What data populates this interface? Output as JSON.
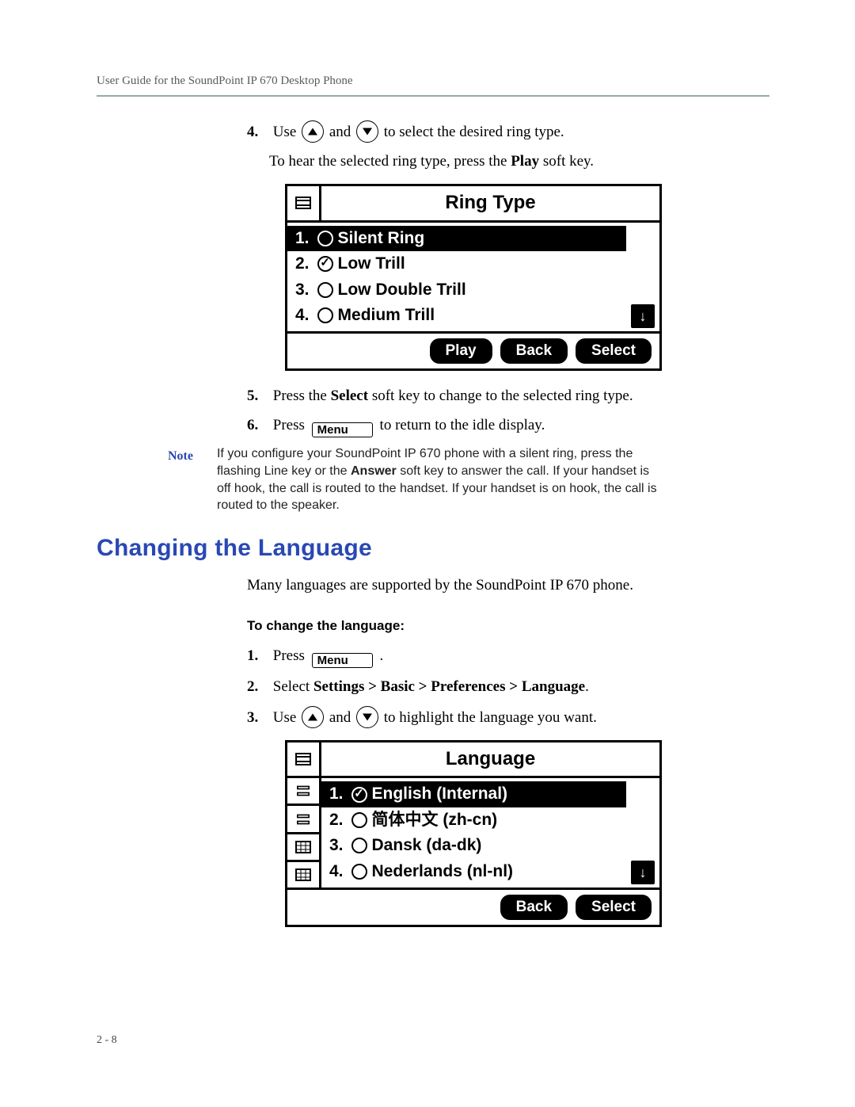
{
  "running_head": "User Guide for the SoundPoint IP 670 Desktop Phone",
  "steps_a": {
    "s4": {
      "num": "4.",
      "pre": "Use ",
      "mid": " and ",
      "post": " to select the desired ring type."
    },
    "s4b": {
      "pre": "To hear the selected ring type, press the ",
      "bold": "Play",
      "post": " soft key."
    },
    "s5": {
      "num": "5.",
      "pre": "Press the ",
      "bold": "Select",
      "post": " soft key to change to the selected ring type."
    },
    "s6": {
      "num": "6.",
      "pre": "Press ",
      "post": " to return to the idle display."
    }
  },
  "menu_key_label": "Menu",
  "ring_panel": {
    "title": "Ring Type",
    "items": [
      {
        "n": "1.",
        "checked": false,
        "label": "Silent Ring",
        "selected": true
      },
      {
        "n": "2.",
        "checked": true,
        "label": "Low Trill",
        "selected": false
      },
      {
        "n": "3.",
        "checked": false,
        "label": "Low Double Trill",
        "selected": false
      },
      {
        "n": "4.",
        "checked": false,
        "label": "Medium Trill",
        "selected": false
      }
    ],
    "softkeys": [
      "Play",
      "Back",
      "Select"
    ]
  },
  "note": {
    "label": "Note",
    "text_a": "If you configure your SoundPoint IP 670 phone with a silent ring, press the flashing Line key or the ",
    "bold": "Answer",
    "text_b": " soft key to answer the call. If your handset is off hook, the call is routed to the handset. If your handset is on hook, the call is routed to the speaker."
  },
  "section_title": "Changing the Language",
  "intro": "Many languages are supported by the SoundPoint IP 670 phone.",
  "subhead": "To change the language:",
  "steps_b": {
    "s1": {
      "num": "1.",
      "pre": "Press ",
      "post": " ."
    },
    "s2": {
      "num": "2.",
      "pre": "Select ",
      "bold": "Settings > Basic > Preferences > Language",
      "post": "."
    },
    "s3": {
      "num": "3.",
      "pre": "Use ",
      "mid": " and ",
      "post": " to highlight the language you want."
    }
  },
  "lang_panel": {
    "title": "Language",
    "items": [
      {
        "n": "1.",
        "checked": true,
        "label": "English (Internal)",
        "selected": true
      },
      {
        "n": "2.",
        "checked": false,
        "label": "简体中文 (zh-cn)",
        "selected": false
      },
      {
        "n": "3.",
        "checked": false,
        "label": "Dansk (da-dk)",
        "selected": false
      },
      {
        "n": "4.",
        "checked": false,
        "label": "Nederlands (nl-nl)",
        "selected": false
      }
    ],
    "softkeys": [
      "Back",
      "Select"
    ]
  },
  "page_num": "2 - 8"
}
